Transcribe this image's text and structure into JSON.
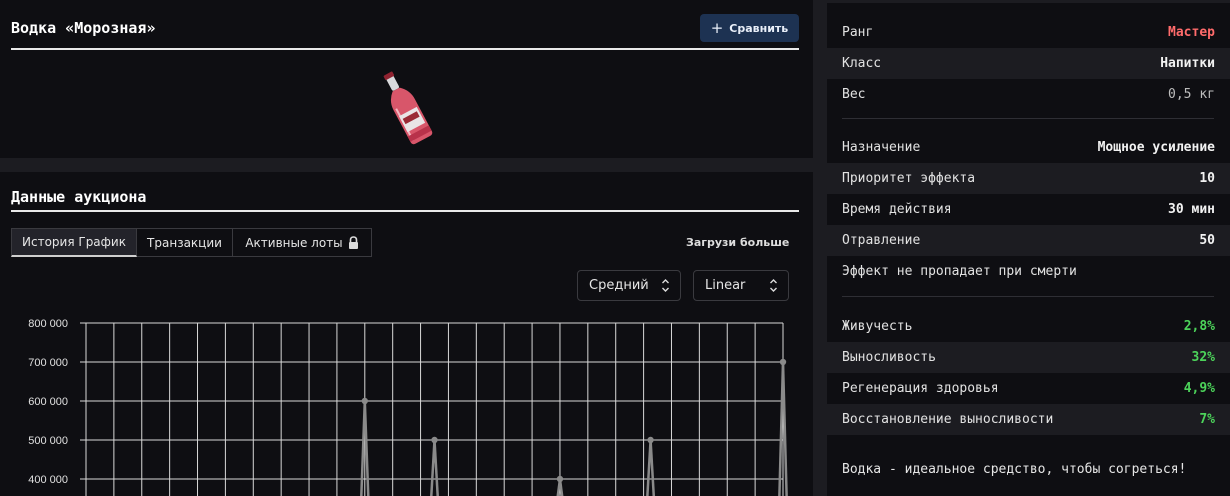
{
  "item": {
    "title": "Водка «Морозная»",
    "compare_label": "Сравнить",
    "compare_icon": "plus-icon"
  },
  "auction": {
    "title": "Данные аукциона",
    "tabs": [
      {
        "label": "История График",
        "active": true
      },
      {
        "label": "Транзакции",
        "active": false
      },
      {
        "label": "Активные лоты",
        "active": false,
        "icon": "lock-icon"
      }
    ],
    "load_more": "Загрузи больше",
    "avg_select": "Средний",
    "scale_select": "Linear"
  },
  "chart_data": {
    "type": "line",
    "y_tick_labels": [
      "800 000",
      "700 000",
      "600 000",
      "500 000",
      "400 000"
    ],
    "ylim": [
      400000,
      800000
    ],
    "grid": true,
    "series": [
      {
        "color": "#8a8a8a",
        "points": [
          {
            "x": 0.4,
            "y": 600000
          },
          {
            "x": 0.5,
            "y": 500000
          },
          {
            "x": 0.68,
            "y": 400000
          },
          {
            "x": 0.81,
            "y": 500000
          },
          {
            "x": 1.0,
            "y": 700000
          }
        ]
      }
    ]
  },
  "stats": {
    "group1": [
      {
        "label": "Ранг",
        "value": "Мастер",
        "style": "rank"
      },
      {
        "label": "Класс",
        "value": "Напитки",
        "style": "bold"
      },
      {
        "label": "Вес",
        "value": "0,5 кг",
        "style": "dim"
      }
    ],
    "group2": [
      {
        "label": "Назначение",
        "value": "Мощное усиление",
        "style": "bold"
      },
      {
        "label": "Приоритет эффекта",
        "value": "10",
        "style": "bold"
      },
      {
        "label": "Время действия",
        "value": "30 мин",
        "style": "bold"
      },
      {
        "label": "Отравление",
        "value": "50",
        "style": "bold"
      },
      {
        "label": "Эффект не пропадает при смерти",
        "value": "",
        "style": "bold"
      }
    ],
    "group3": [
      {
        "label": "Живучесть",
        "value": "2,8%",
        "style": "green"
      },
      {
        "label": "Выносливость",
        "value": "32%",
        "style": "green"
      },
      {
        "label": "Регенерация здоровья",
        "value": "4,9%",
        "style": "green"
      },
      {
        "label": "Восстановление выносливости",
        "value": "7%",
        "style": "green"
      }
    ],
    "description": "Водка - идеальное средство, чтобы согреться!"
  }
}
